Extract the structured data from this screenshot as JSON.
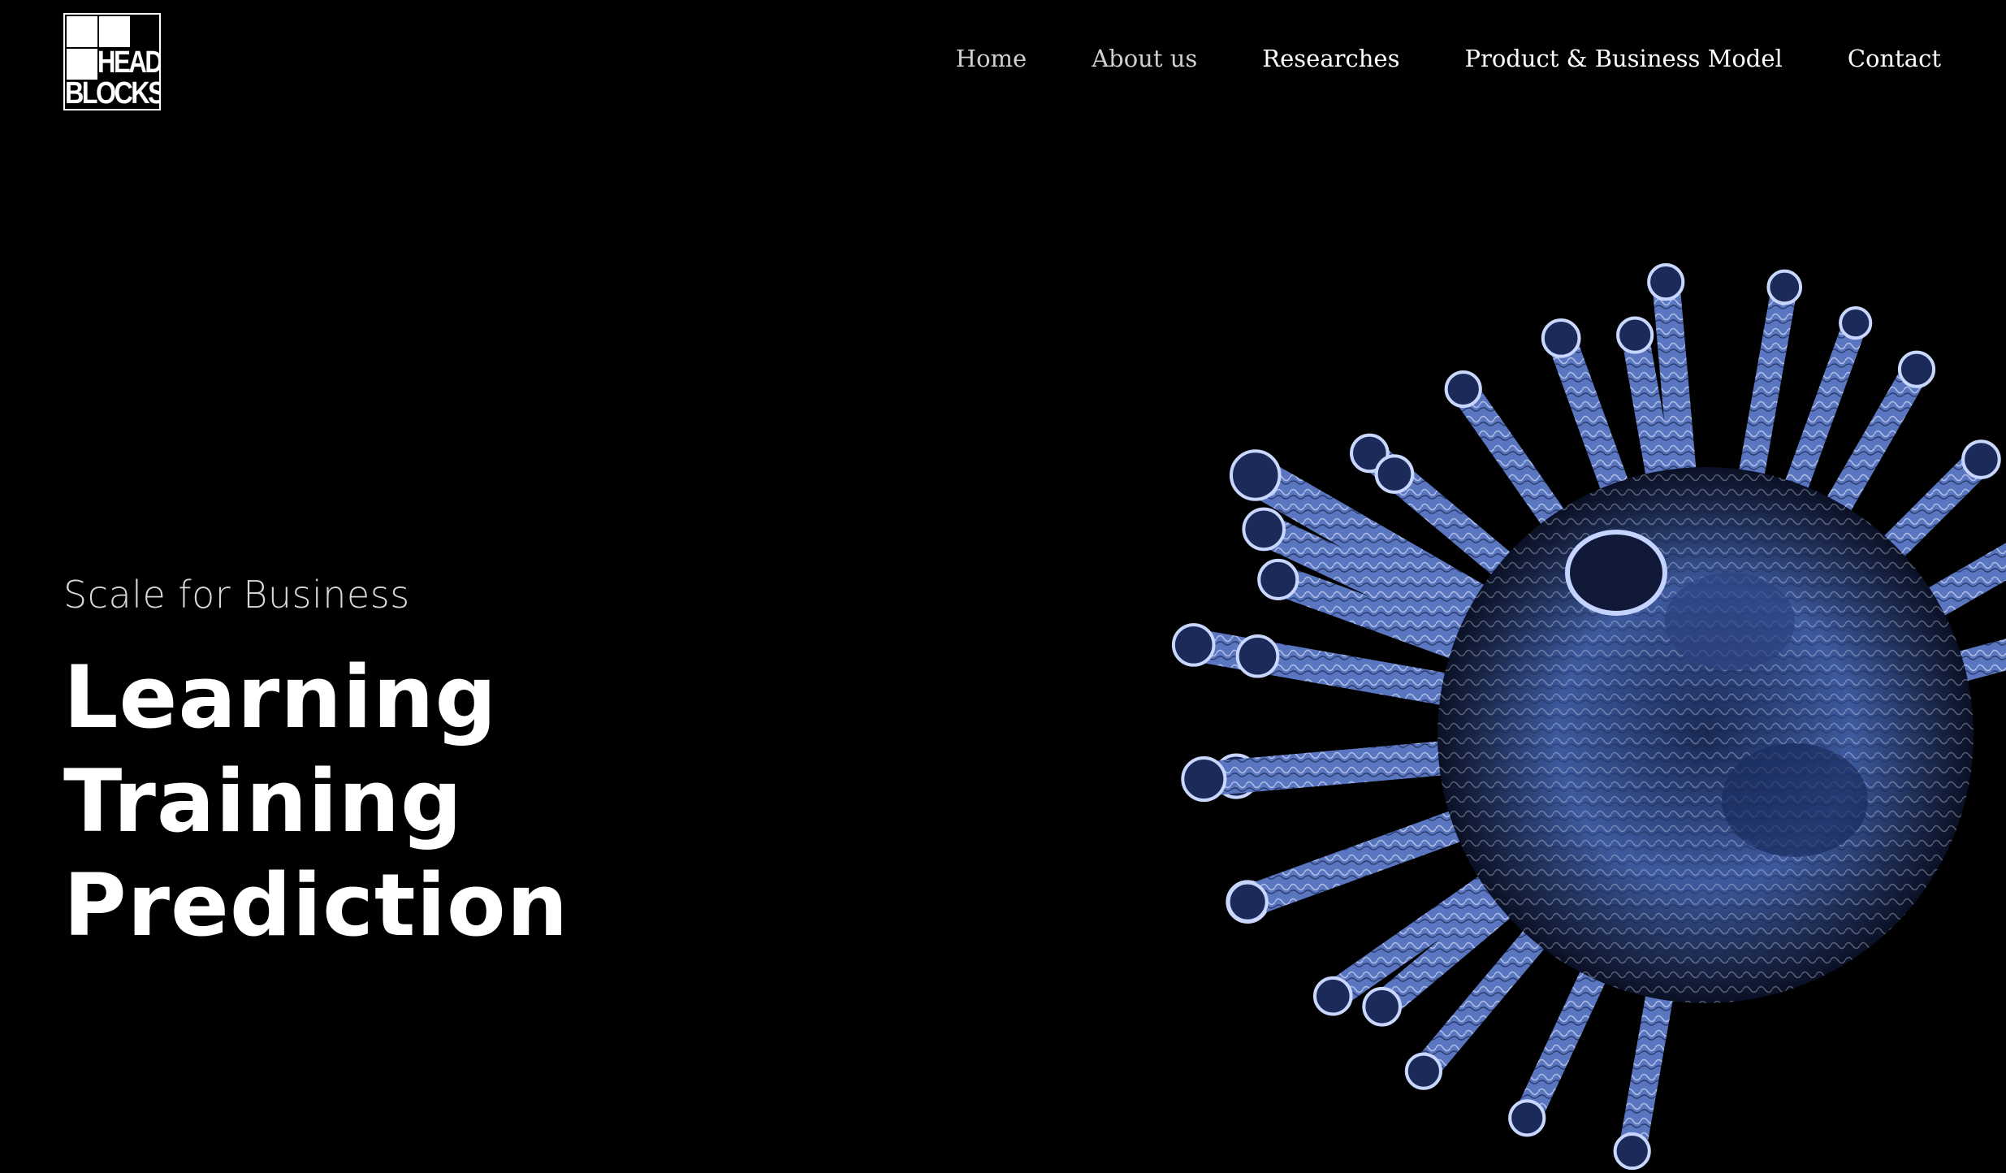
{
  "header": {
    "logo": {
      "line1": "HEAD",
      "line2": "BLOCKS"
    },
    "nav": [
      {
        "label": "Home"
      },
      {
        "label": "About us"
      },
      {
        "label": "Researches"
      },
      {
        "label": "Product & Business Model"
      },
      {
        "label": "Contact"
      }
    ]
  },
  "hero": {
    "subtitle": "Scale for Business",
    "headline": [
      "Learning",
      "Training",
      "Prediction"
    ],
    "image": {
      "icon": "virus-illustration",
      "accent_color": "#7d9be0"
    }
  }
}
